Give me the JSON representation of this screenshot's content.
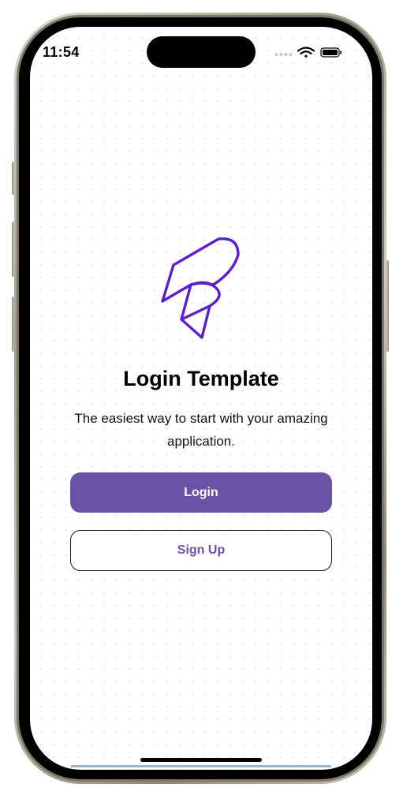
{
  "status_bar": {
    "time": "11:54",
    "icons": [
      "signal-icon",
      "wifi-icon",
      "battery-icon"
    ]
  },
  "logo": {
    "icon": "paper-plane-logo-icon",
    "color": "#5b1fd0"
  },
  "title": "Login Template",
  "subtitle": "The easiest way to start with your amazing application.",
  "buttons": {
    "login_label": "Login",
    "signup_label": "Sign Up"
  },
  "colors": {
    "accent": "#6a53a6",
    "logo": "#5b1fd0"
  }
}
